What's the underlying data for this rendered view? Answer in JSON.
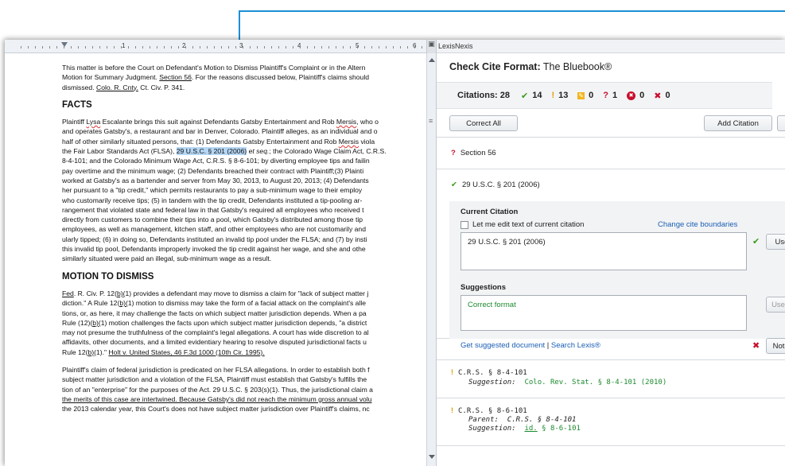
{
  "document": {
    "intro": [
      "This matter is before the Court on Defendant's Motion to Dismiss Plaintiff's Complaint or in the Altern",
      "Motion for Summary Judgment. ",
      "Section 56",
      ". For the reasons discussed below, Plaintiff's claims should",
      "dismissed. ",
      "Colo. R. Cnty.",
      " Ct. Civ. P. 341."
    ],
    "facts_heading": "FACTS",
    "facts_lines": [
      [
        "Plaintiff ",
        "Lysa",
        " Escalante brings this suit against Defendants Gatsby Entertainment and Rob ",
        "Mersis",
        ", who o"
      ],
      [
        "and operates Gatsby's, a restaurant and bar in Denver, Colorado. Plaintiff alleges, as an individual and o",
        "",
        "",
        "",
        ""
      ],
      [
        "half of other similarly situated persons, that: (1) Defendants Gatsby Entertainment and Rob ",
        "Mersis",
        " viola",
        "",
        ""
      ],
      [
        "the Fair Labor Standards Act (FLSA), ",
        "29 U.S.C. § 201 (2006)",
        " et seq.",
        "; the Colorado Wage Claim Act, C.R.S.",
        ""
      ],
      [
        "8-4-101; and the Colorado Minimum Wage Act, C.R.S. § 8-6-101;  by diverting employee tips and failin",
        "",
        "",
        "",
        ""
      ],
      [
        "pay overtime and the minimum wage; (2) Defendants breached their contract with Plaintiff;(3) Plainti",
        "",
        "",
        "",
        ""
      ],
      [
        "worked at Gatsby's as a bartender and server from May 30, 2013, to August 20, 2013; (4) Defendants",
        "",
        "",
        "",
        ""
      ],
      [
        "her pursuant to a \"tip credit,\" which permits restaurants to pay a sub-minimum wage to their employ",
        "",
        "",
        "",
        ""
      ],
      [
        "who customarily receive tips; (5) in tandem with the tip credit, Defendants instituted a tip-pooling ar-",
        "",
        "",
        "",
        ""
      ],
      [
        "rangement that violated state and federal law in that Gatsby's required all employees who received t",
        "",
        "",
        "",
        ""
      ],
      [
        "directly from customers to combine their tips into a pool, which Gatsby's distributed among those tip",
        "",
        "",
        "",
        ""
      ],
      [
        "employees, as well as management, kitchen staff, and other employees who are not customarily and",
        "",
        "",
        "",
        ""
      ],
      [
        "ularly tipped; (6) in doing so, Defendants instituted an invalid tip pool under the FLSA; and (7) by insti",
        "",
        "",
        "",
        ""
      ],
      [
        "this invalid tip pool, Defendants improperly invoked the tip credit against her wage, and she and othe",
        "",
        "",
        "",
        ""
      ],
      [
        "similarly situated were paid an illegal, sub-minimum wage as a result.",
        "",
        "",
        "",
        ""
      ]
    ],
    "motion_heading": "MOTION TO DISMISS",
    "motion_lines": [
      [
        "",
        "Fed",
        ". R. Civ. P. 12(",
        "b)(",
        "1) provides a defendant may move to dismiss a claim for \"lack of subject matter j"
      ],
      [
        "diction.\" A Rule 12(",
        "b)(",
        "1) motion to dismiss may take the form of a facial attack on the complaint's alle",
        "",
        ""
      ],
      [
        "tions, or, as here, it may challenge the facts on which subject matter jurisdiction depends. When a pa",
        "",
        "",
        "",
        ""
      ],
      [
        "Rule (12)(",
        "b)(",
        "1) motion challenges the facts upon which subject matter jurisdiction depends, \"a district",
        "",
        ""
      ],
      [
        "may not presume the truthfulness of the complaint's legal allegations. A court has wide discretion to al",
        "",
        "",
        "",
        ""
      ],
      [
        "affidavits, other documents, and a limited evidentiary hearing to resolve disputed jurisdictional facts u",
        "",
        "",
        "",
        ""
      ],
      [
        "Rule 12(",
        "b)(",
        "1).\" ",
        "Holt v. United States, 46 F.3d 1000  (10th Cir. 1995).",
        ""
      ]
    ],
    "last_lines": [
      "Plaintiff's claim of federal jurisdiction is predicated on her FLSA allegations. In order to establish both f",
      "subject matter jurisdiction and a violation of the FLSA, Plaintiff must establish that Gatsby's fulfills the",
      "tion of an \"enterprise\" for the purposes of the Act. 29 U.S.C. § 203(s)(1). Thus, the jurisdictional claim a",
      "the merits of this case are intertwined. Because Gatsby's did not reach the minimum gross annual volu",
      "the 2013  calendar year, this Court's does not have subject matter jurisdiction over Plaintiff's claims, nc"
    ]
  },
  "ruler": {
    "numbers": [
      "1",
      "2",
      "3",
      "4",
      "5",
      "6"
    ]
  },
  "pane": {
    "title": "LexisNexis",
    "check_label": "Check Cite Format:",
    "check_format": "The Bluebook®",
    "citations_label": "Citations: 28",
    "stats": [
      {
        "icon": "check-icon",
        "symbol": "✔",
        "value": "14",
        "color": "#3b9a1c"
      },
      {
        "icon": "warning-icon",
        "symbol": "!",
        "value": "13",
        "color": "#e0a000"
      },
      {
        "icon": "edited-icon",
        "symbol": "✎",
        "value": "0",
        "color": "#e0a000"
      },
      {
        "icon": "question-icon",
        "symbol": "?",
        "value": "1",
        "color": "#c8102e"
      },
      {
        "icon": "error-circle-icon",
        "symbol": "✖",
        "value": "0",
        "color": "#c8102e"
      },
      {
        "icon": "x-icon",
        "symbol": "✖",
        "value": "0",
        "color": "#c8102e"
      }
    ],
    "correct_all": "Correct All",
    "add_citation": "Add Citation",
    "items": {
      "section56": "Section 56",
      "usc": "29 U.S.C. § 201 (2006)",
      "current_citation_label": "Current Citation",
      "edit_checkbox_label": "Let me edit text of current citation",
      "change_boundaries": "Change cite boundaries",
      "current_value": "29 U.S.C. § 201 (2006)",
      "use_label": "Use",
      "suggestions_label": "Suggestions",
      "suggestion_value": "Correct format",
      "use_s_label": "Use S",
      "get_doc": "Get suggested document",
      "sep": " | ",
      "search_lexis": "Search Lexis®",
      "not_label": "Not a",
      "crs1": "C.R.S. § 8-4-101",
      "crs1_sugg_label": "Suggestion:",
      "crs1_sugg": "Colo. Rev. Stat. § 8-4-101 (2010)",
      "crs2": "C.R.S. § 8-6-101",
      "crs2_parent_label": "Parent:",
      "crs2_parent": "C.R.S. § 8-4-101",
      "crs2_sugg_label": "Suggestion:",
      "crs2_sugg_id": "id.",
      "crs2_sugg_rest": " § 8-6-101"
    }
  }
}
